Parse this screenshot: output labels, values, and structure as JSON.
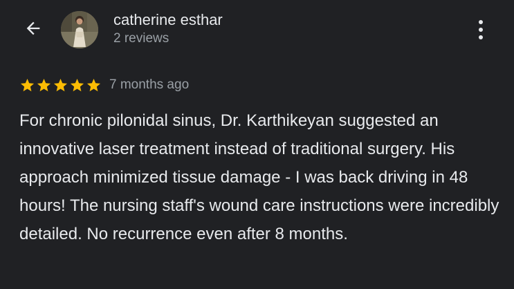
{
  "header": {
    "back_icon": "arrow-back-icon",
    "author_name": "catherine esthar",
    "review_count": "2 reviews",
    "more_icon": "more-vertical-icon"
  },
  "review": {
    "rating": 5,
    "max_rating": 5,
    "time_ago": "7 months ago",
    "text": "For chronic pilonidal sinus, Dr. Karthikeyan suggested an innovative laser treatment instead of traditional surgery. His approach minimized tissue damage - I was back driving in 48 hours! The nursing staff's wound care instructions were incredibly detailed. No recurrence even after 8 months."
  },
  "colors": {
    "background": "#202124",
    "primary_text": "#e8eaed",
    "secondary_text": "#9aa0a6",
    "star": "#fbbc04"
  }
}
